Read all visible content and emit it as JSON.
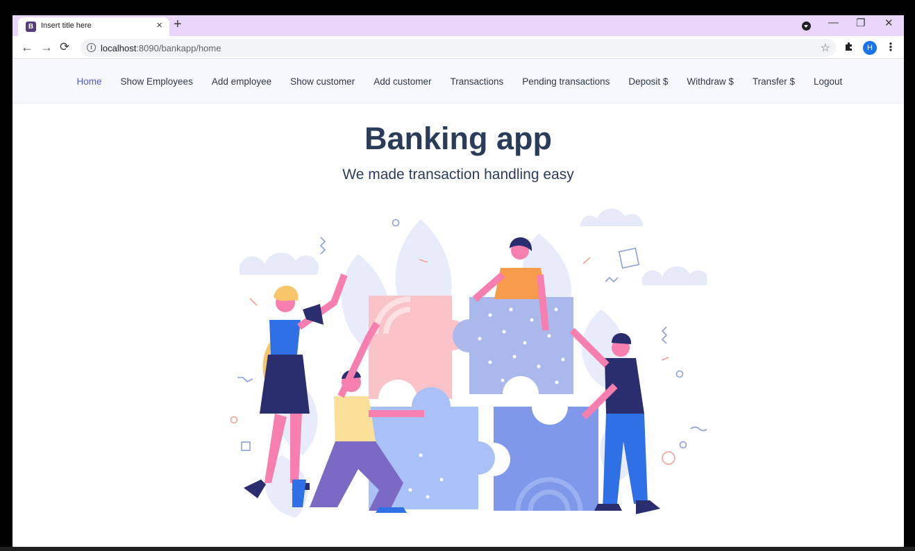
{
  "browser": {
    "tab_title": "Insert title here",
    "favicon_letter": "B",
    "tab_close": "×",
    "new_tab": "+",
    "url_host": "localhost",
    "url_path": ":8090/bankapp/home",
    "avatar_letter": "H",
    "icons": {
      "back": "back-arrow-icon",
      "forward": "forward-arrow-icon",
      "reload": "reload-icon",
      "info": "info-icon",
      "bookmark": "star-icon",
      "extensions": "puzzle-icon",
      "menu": "kebab-menu-icon",
      "profile": "profile-icon"
    },
    "colors": {
      "tabstrip": "#e9d6fa",
      "avatar": "#1a73e8"
    }
  },
  "navbar": {
    "items": [
      {
        "label": "Home",
        "active": true
      },
      {
        "label": "Show Employees"
      },
      {
        "label": "Add employee"
      },
      {
        "label": "Show customer"
      },
      {
        "label": "Add customer"
      },
      {
        "label": "Transactions"
      },
      {
        "label": "Pending transactions"
      },
      {
        "label": "Deposit $"
      },
      {
        "label": "Withdraw $"
      },
      {
        "label": "Transfer $"
      },
      {
        "label": "Logout"
      }
    ],
    "colors": {
      "active": "#4e5bd6",
      "text": "#2d3748"
    }
  },
  "hero": {
    "title": "Banking app",
    "subtitle": "We made transaction handling easy",
    "color": "#2a3c5a"
  }
}
